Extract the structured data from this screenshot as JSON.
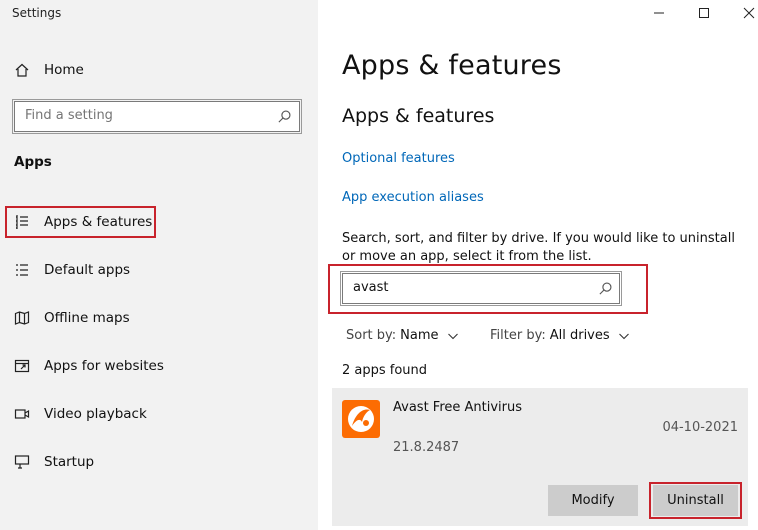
{
  "window": {
    "title": "Settings",
    "minimize_glyph": "—",
    "maximize_glyph": "☐",
    "close_glyph": "✕"
  },
  "sidebar": {
    "home_label": "Home",
    "search_placeholder": "Find a setting",
    "section_label": "Apps",
    "items": [
      {
        "label": "Apps & features",
        "icon": "list-icon"
      },
      {
        "label": "Default apps",
        "icon": "default-apps-icon"
      },
      {
        "label": "Offline maps",
        "icon": "map-icon"
      },
      {
        "label": "Apps for websites",
        "icon": "link-window-icon"
      },
      {
        "label": "Video playback",
        "icon": "video-icon"
      },
      {
        "label": "Startup",
        "icon": "startup-icon"
      }
    ]
  },
  "main": {
    "page_title": "Apps & features",
    "section_title": "Apps & features",
    "links": [
      "Optional features",
      "App execution aliases"
    ],
    "description": "Search, sort, and filter by drive. If you would like to uninstall or move an app, select it from the list.",
    "filter_value": "avast",
    "sort_label": "Sort by:",
    "sort_value": "Name",
    "filter_label": "Filter by:",
    "filter_drive": "All drives",
    "found_text": "2 apps found",
    "app": {
      "name": "Avast Free Antivirus",
      "date": "04-10-2021",
      "version": "21.8.2487",
      "modify_label": "Modify",
      "uninstall_label": "Uninstall"
    }
  },
  "colors": {
    "accent_link": "#0067b8",
    "highlight_red": "#c8232c",
    "avast_orange": "#fc6c03",
    "sidebar_bg": "#f2f2f2"
  }
}
